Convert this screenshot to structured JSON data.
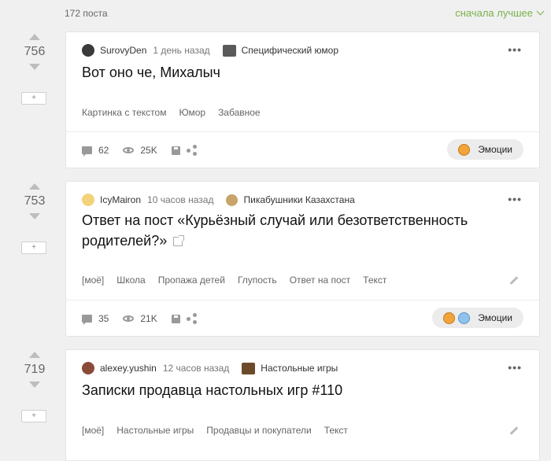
{
  "header": {
    "post_count": "172 поста",
    "sort_label": "сначала лучшее"
  },
  "save_button_label": "+",
  "more_label": "•••",
  "emotions_label": "Эмоции",
  "posts": [
    {
      "rating": "756",
      "author": "SurovyDen",
      "time": "1 день назад",
      "community": "Специфический юмор",
      "title": "Вот оно че, Михалыч",
      "tags": [
        "Картинка с текстом",
        "Юмор",
        "Забавное"
      ],
      "comments": "62",
      "views": "25K"
    },
    {
      "rating": "753",
      "author": "IcyMairon",
      "time": "10 часов назад",
      "community": "Пикабушники Казахстана",
      "title_line1": "Ответ на пост «Курьёзный случай или безответственность",
      "title_line2": "родителей?»",
      "tags": [
        "[моё]",
        "Школа",
        "Пропажа детей",
        "Глупость",
        "Ответ на пост",
        "Текст"
      ],
      "comments": "35",
      "views": "21K"
    },
    {
      "rating": "719",
      "author": "alexey.yushin",
      "time": "12 часов назад",
      "community": "Настольные игры",
      "title": "Записки продавца настольных игр #110",
      "tags": [
        "[моё]",
        "Настольные игры",
        "Продавцы и покупатели",
        "Текст"
      ]
    }
  ],
  "colors": {
    "accent_green": "#7bb24a",
    "page_bg": "#f0f0f0",
    "card_bg": "#ffffff"
  }
}
